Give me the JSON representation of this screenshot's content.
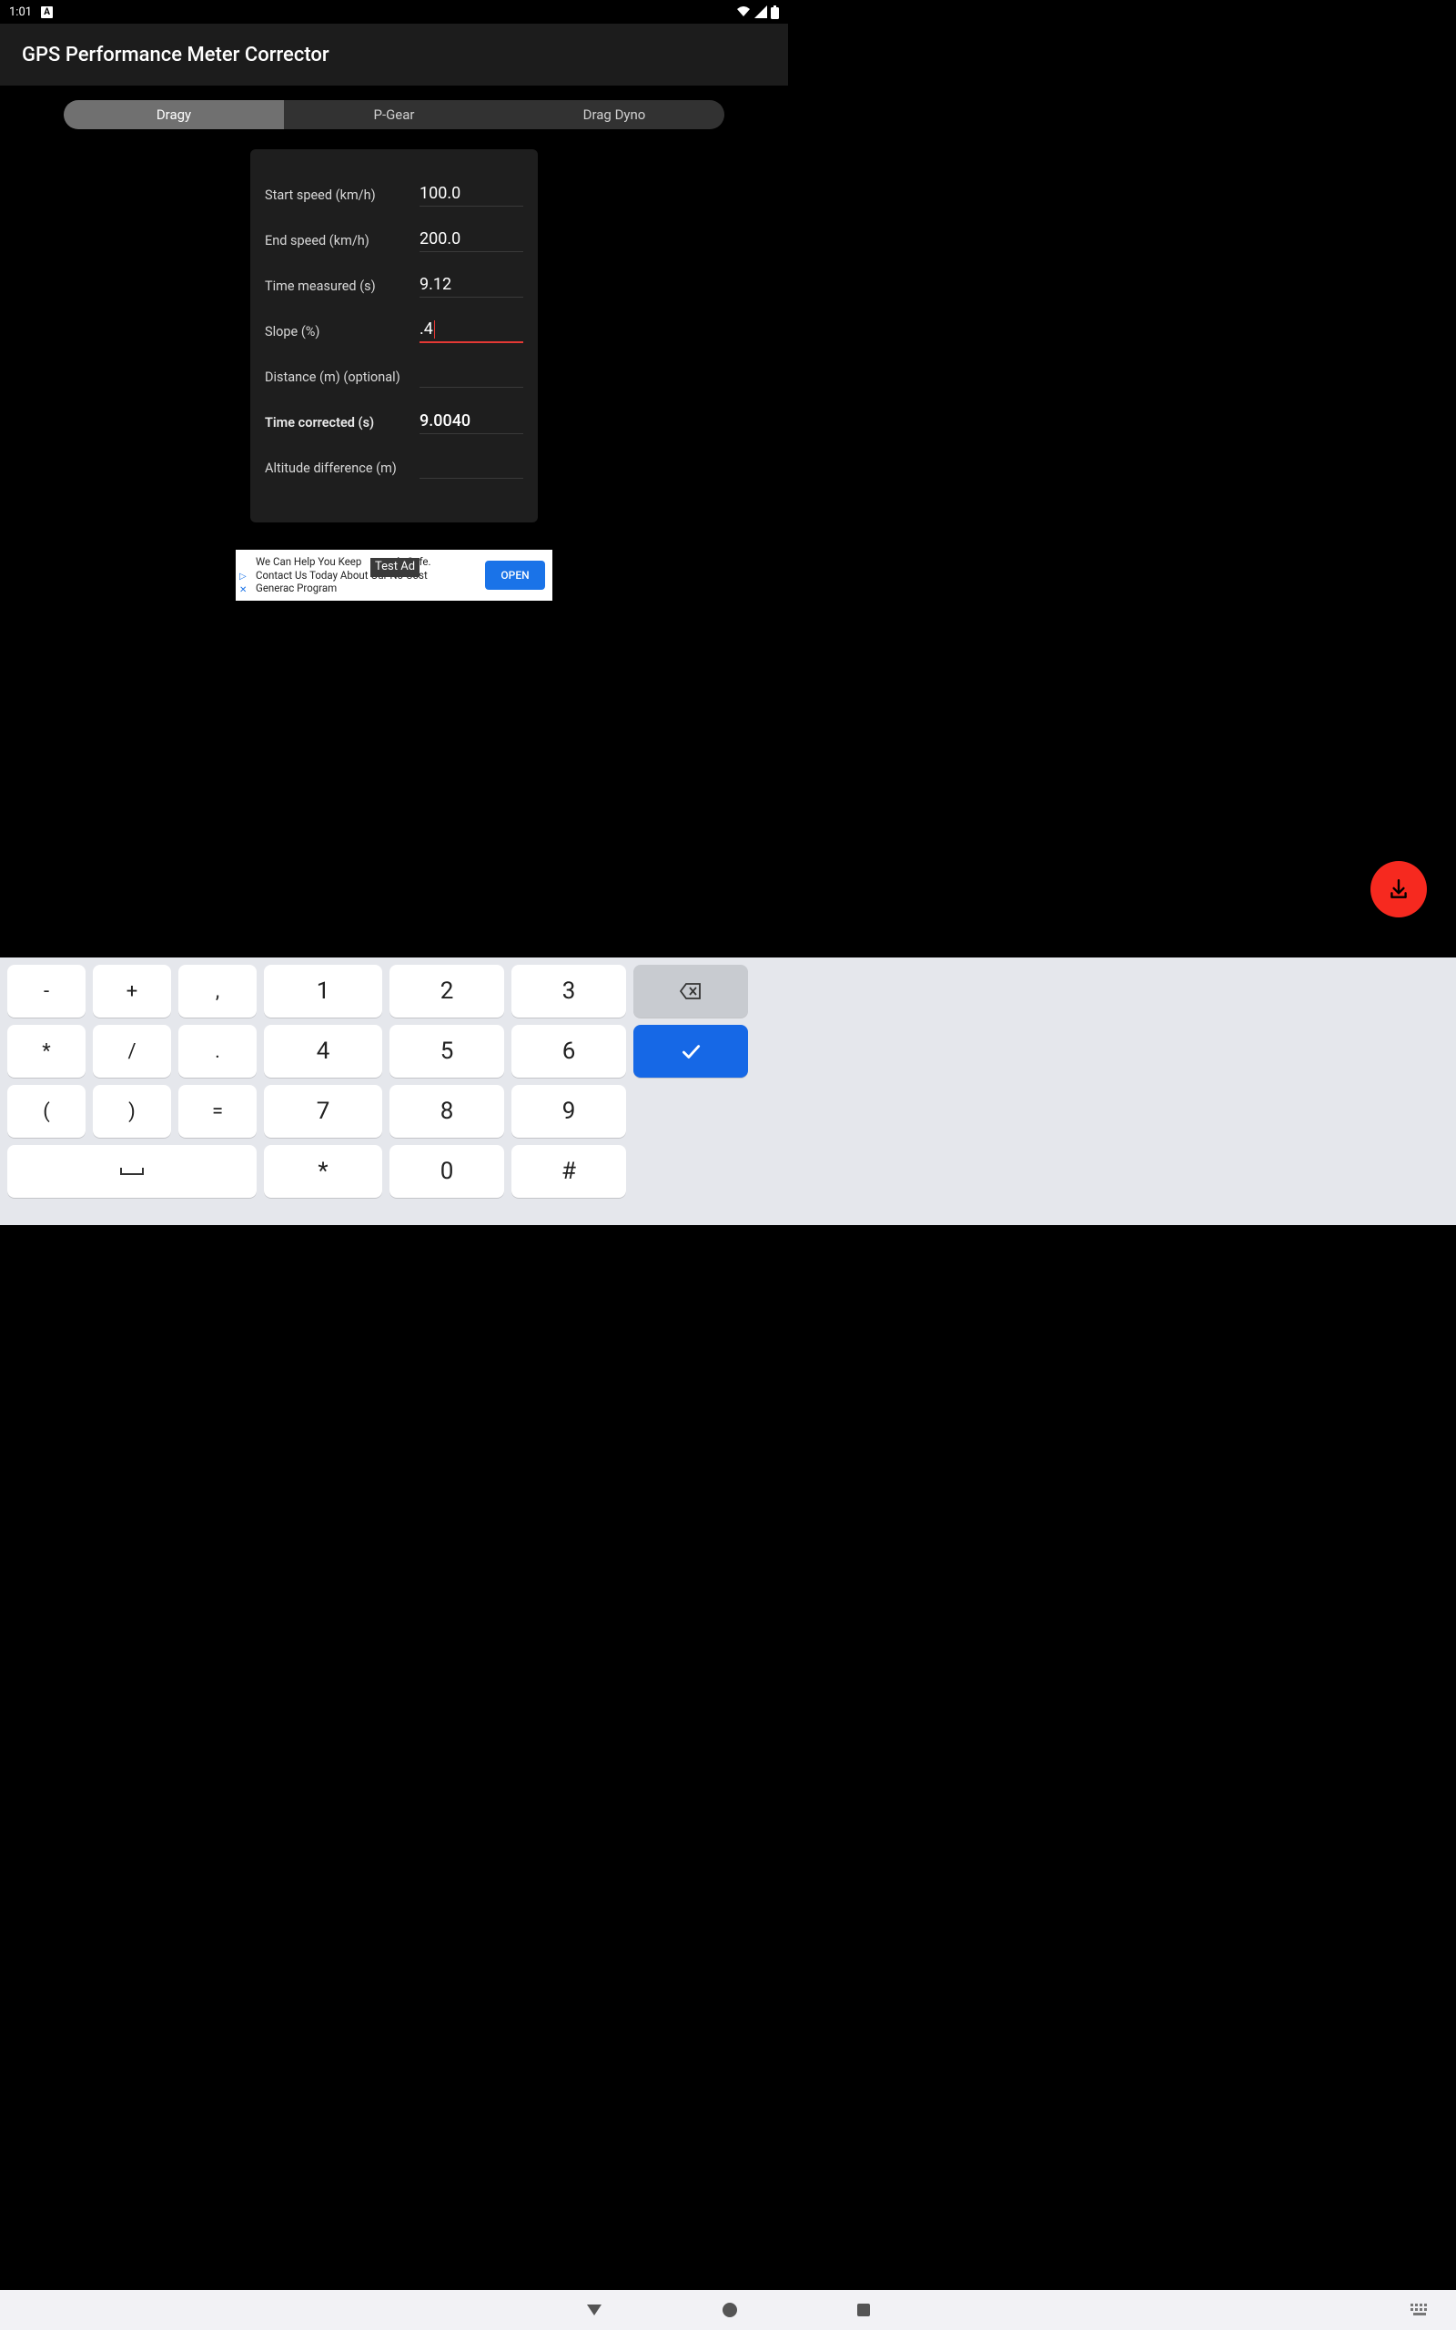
{
  "status": {
    "time": "1:01",
    "app_icon": "A"
  },
  "header": {
    "title": "GPS Performance Meter Corrector"
  },
  "tabs": {
    "dragy": "Dragy",
    "pgear": "P-Gear",
    "dragdyno": "Drag Dyno"
  },
  "form": {
    "start_speed": {
      "label": "Start speed (km/h)",
      "value": "100.0"
    },
    "end_speed": {
      "label": "End speed (km/h)",
      "value": "200.0"
    },
    "time_measured": {
      "label": "Time measured (s)",
      "value": "9.12"
    },
    "slope": {
      "label": "Slope (%)",
      "value": ".4"
    },
    "distance": {
      "label": "Distance (m) (optional)",
      "value": ""
    },
    "time_corrected": {
      "label": "Time corrected (s)",
      "value": "9.0040"
    },
    "altitude_diff": {
      "label": "Altitude difference (m)",
      "value": ""
    }
  },
  "ad": {
    "line1": "We Can Help You Keep",
    "line1b": "ly Safe.",
    "line2": "Contact Us Today About Our No Cost",
    "line3": "Generac Program",
    "badge": "Test Ad",
    "cta": "OPEN"
  },
  "keypad": {
    "minus": "-",
    "plus": "+",
    "comma": ",",
    "one": "1",
    "two": "2",
    "three": "3",
    "star": "*",
    "slash": "/",
    "dot": ".",
    "four": "4",
    "five": "5",
    "six": "6",
    "lparen": "(",
    "rparen": ")",
    "equals": "=",
    "seven": "7",
    "eight": "8",
    "nine": "9",
    "space": "␣",
    "star2": "*",
    "zero": "0",
    "hash": "#"
  }
}
